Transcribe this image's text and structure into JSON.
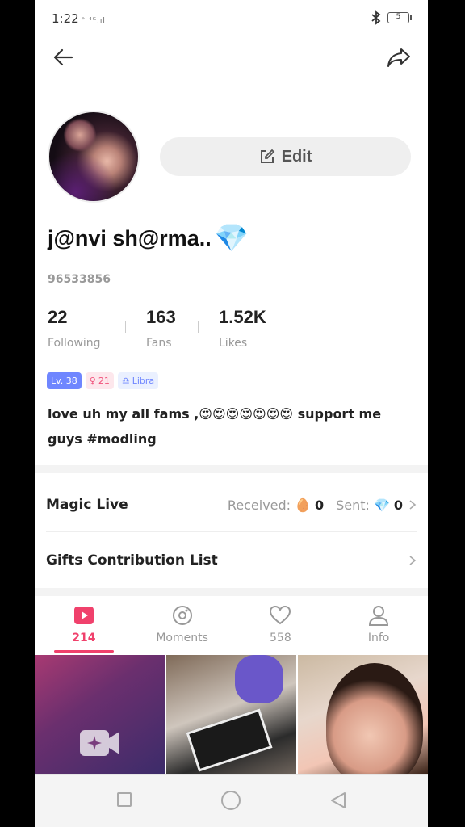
{
  "status_bar": {
    "time": "1:22",
    "signal_extra": "° ⁴ᴳ.ıl",
    "battery_level": "5"
  },
  "header": {
    "back_icon": "arrow-left-icon",
    "share_icon": "share-arrow-icon"
  },
  "profile": {
    "avatar": "profile-photo",
    "edit_label": "Edit",
    "name": "j@nvi sh@rma..",
    "name_emoji": "💎",
    "user_id": "96533856",
    "stats": [
      {
        "value": "22",
        "label": "Following"
      },
      {
        "value": "163",
        "label": "Fans"
      },
      {
        "value": "1.52K",
        "label": "Likes"
      }
    ],
    "tags": {
      "level": "Lv. 38",
      "gender_symbol": "♀",
      "age": "21",
      "zodiac_symbol": "♎",
      "zodiac": "Libra"
    },
    "bio": "love uh my all fams ,😍😍😍😍😍😍😍 support me guys #modling"
  },
  "magic_live": {
    "title": "Magic Live",
    "received_label": "Received:",
    "received_emoji": "🥚",
    "received_count": "0",
    "sent_label": "Sent:",
    "sent_emoji": "💎",
    "sent_count": "0"
  },
  "gifts": {
    "title": "Gifts Contribution List"
  },
  "tabs": [
    {
      "label": "214",
      "icon": "play-video-icon",
      "active": true
    },
    {
      "label": "Moments",
      "icon": "moments-icon"
    },
    {
      "label": "558",
      "icon": "heart-icon"
    },
    {
      "label": "Info",
      "icon": "person-icon"
    }
  ],
  "colors": {
    "accent": "#f0416c",
    "level_badge": "#6f86ff"
  }
}
